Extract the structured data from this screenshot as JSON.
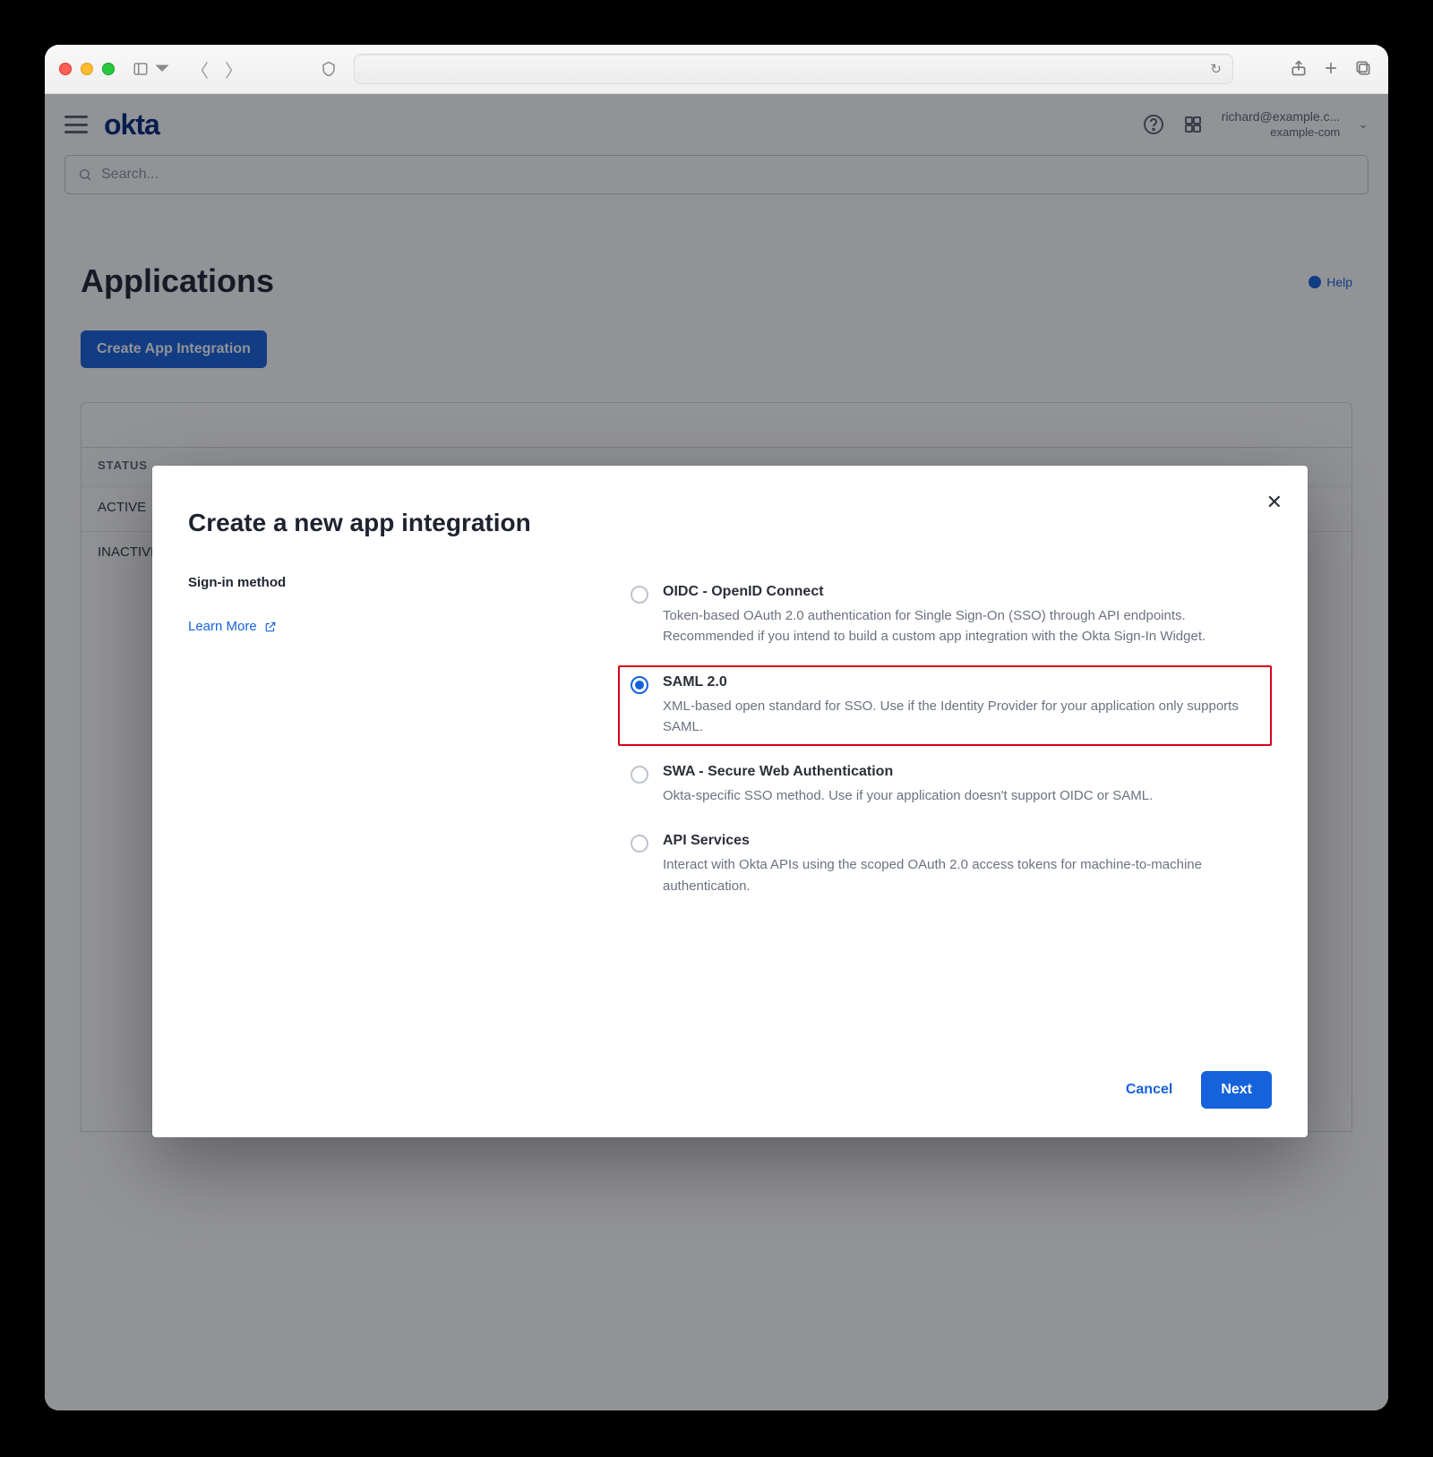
{
  "browser": {
    "address": "",
    "refresh_glyph": "↻"
  },
  "okta": {
    "logo_text": "okta",
    "user_line1": "richard@example.c...",
    "user_line2": "example-com",
    "search_placeholder": "Search..."
  },
  "page": {
    "title": "Applications",
    "help_label": "Help",
    "create_button": "Create App Integration",
    "col_header": "STATUS",
    "row_active": "ACTIVE",
    "row_inactive": "INACTIVE"
  },
  "dialog": {
    "title": "Create a new app integration",
    "section_label": "Sign-in method",
    "learn_more": "Learn More",
    "cancel": "Cancel",
    "next": "Next",
    "options": [
      {
        "id": "oidc",
        "title": "OIDC - OpenID Connect",
        "desc": "Token-based OAuth 2.0 authentication for Single Sign-On (SSO) through API endpoints. Recommended if you intend to build a custom app integration with the Okta Sign-In Widget.",
        "selected": false,
        "highlight": false
      },
      {
        "id": "saml",
        "title": "SAML 2.0",
        "desc": "XML-based open standard for SSO. Use if the Identity Provider for your application only supports SAML.",
        "selected": true,
        "highlight": true
      },
      {
        "id": "swa",
        "title": "SWA - Secure Web Authentication",
        "desc": "Okta-specific SSO method. Use if your application doesn't support OIDC or SAML.",
        "selected": false,
        "highlight": false
      },
      {
        "id": "api",
        "title": "API Services",
        "desc": "Interact with Okta APIs using the scoped OAuth 2.0 access tokens for machine-to-machine authentication.",
        "selected": false,
        "highlight": false
      }
    ]
  },
  "colors": {
    "primary": "#1662dd",
    "highlight_border": "#d9001b",
    "text": "#1f2330",
    "muted": "#6b7280"
  }
}
